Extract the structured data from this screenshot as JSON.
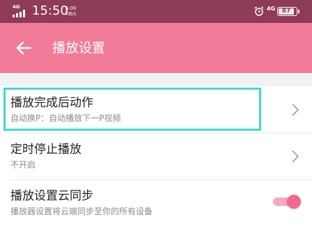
{
  "status_bar": {
    "network_type": "4G",
    "time": "15:50",
    "speed_value": "4.00",
    "speed_unit": "KB/s",
    "net_indicator": "4G",
    "battery_level": "87"
  },
  "app_bar": {
    "title": "播放设置",
    "back_icon": "arrow-left-icon",
    "color": "#f37b9a"
  },
  "settings": [
    {
      "title": "播放完成后动作",
      "subtitle": "自动换P：自动播放下一P视频",
      "control": "chevron",
      "highlighted": true
    },
    {
      "title": "定时停止播放",
      "subtitle": "不开启",
      "control": "chevron"
    },
    {
      "title": "播放设置云同步",
      "subtitle": "播放器设置将云端同步至你的所有设备",
      "control": "toggle",
      "toggle_on": true
    }
  ],
  "colors": {
    "status_bar": "#8e3b57",
    "accent": "#f0698f",
    "highlight_border": "#3ed9d2"
  }
}
